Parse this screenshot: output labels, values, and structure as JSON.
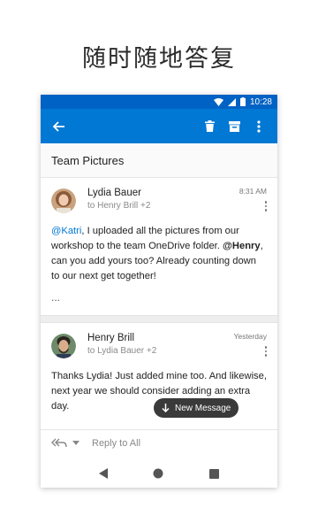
{
  "headline": "随时随地答复",
  "status_bar": {
    "time": "10:28"
  },
  "app_bar": {
    "back_icon": "arrow-left-icon",
    "actions": [
      "trash-icon",
      "archive-icon",
      "more-vert-icon"
    ]
  },
  "thread": {
    "subject": "Team Pictures",
    "messages": [
      {
        "sender": "Lydia Bauer",
        "recipients": "to Henry Brill +2",
        "time": "8:31 AM",
        "body": {
          "mention1": "@Katri",
          "text1": ", I uploaded all the pictures from our workshop to the team OneDrive folder. ",
          "mention2": "@Henry",
          "text2": ", can you add yours too? Already counting down to our next get together!"
        },
        "collapsed": "..."
      },
      {
        "sender": "Henry Brill",
        "recipients": "to Lydia Bauer +2",
        "time": "Yesterday",
        "body": {
          "text": "Thanks Lydia! Just added mine too. And likewise, next year we should consider adding an extra day."
        }
      }
    ]
  },
  "new_message_button": "New Message",
  "reply_bar": {
    "label": "Reply to All"
  },
  "colors": {
    "accent": "#0078d4",
    "status_bar": "#0062c4"
  }
}
